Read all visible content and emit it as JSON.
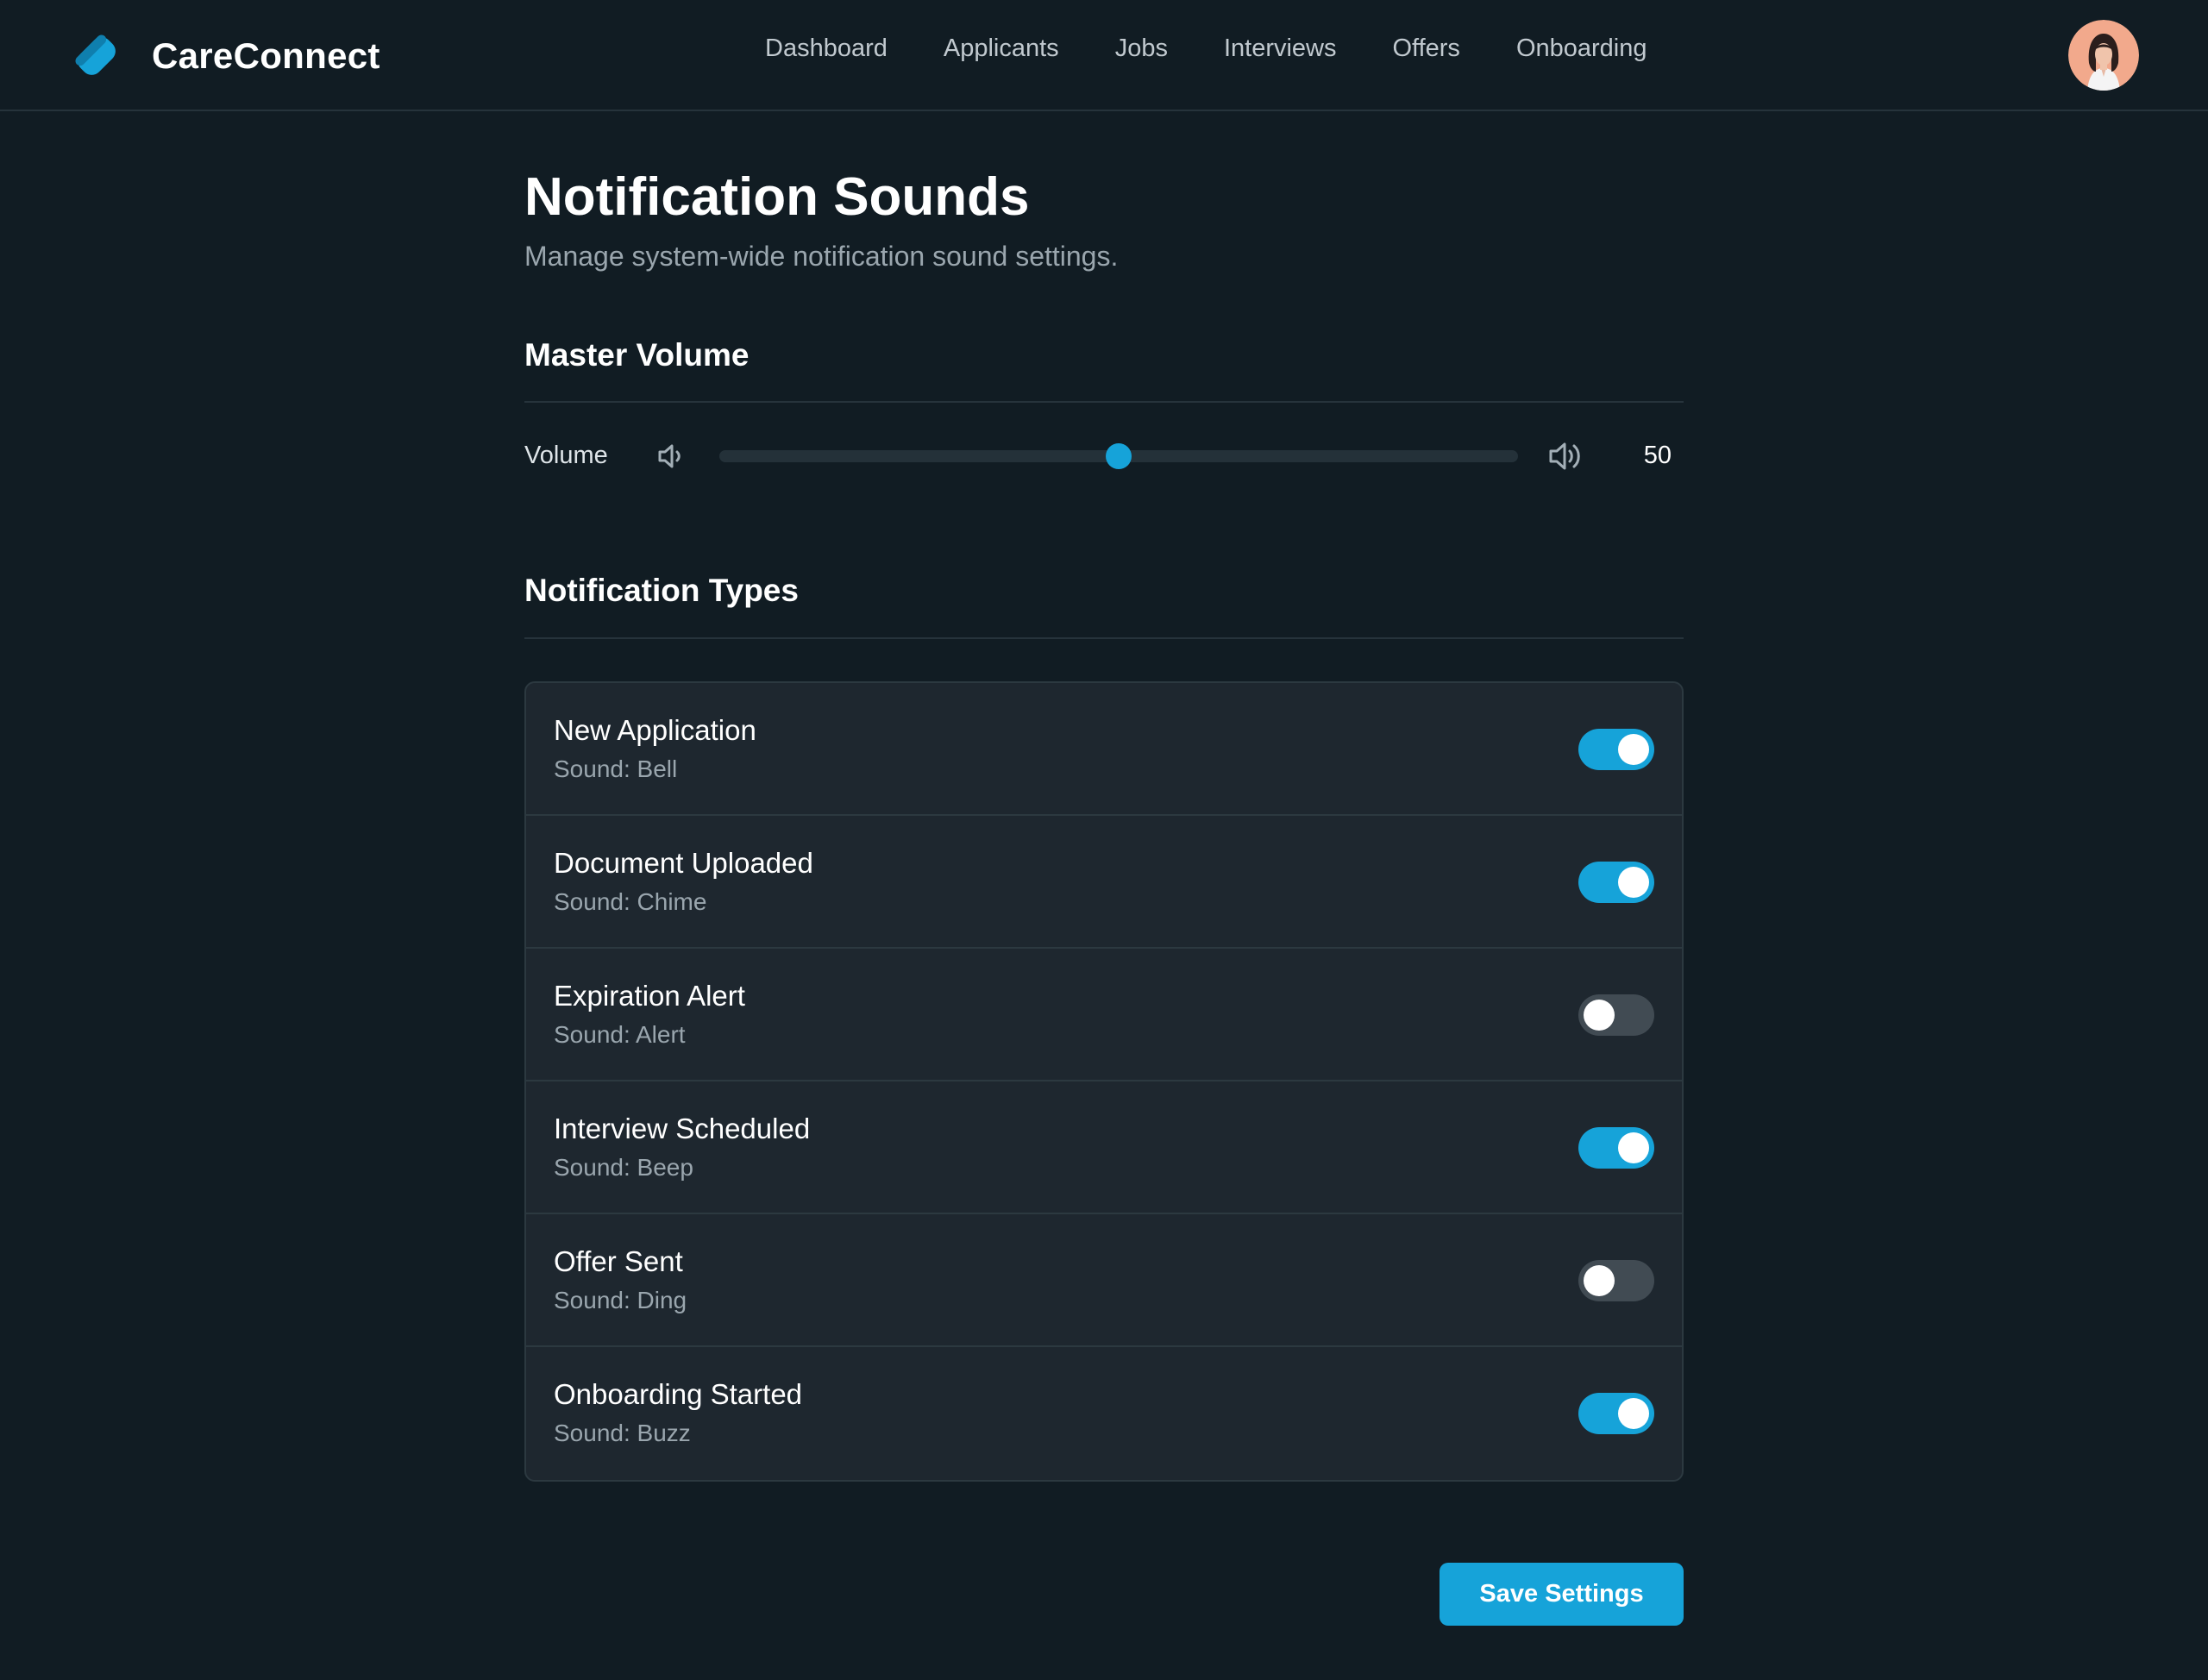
{
  "app": {
    "name": "CareConnect",
    "accent_color": "#16a3d9",
    "logo_icon": "tag-icon"
  },
  "nav": {
    "items": [
      {
        "label": "Dashboard"
      },
      {
        "label": "Applicants"
      },
      {
        "label": "Jobs"
      },
      {
        "label": "Interviews"
      },
      {
        "label": "Offers"
      },
      {
        "label": "Onboarding"
      }
    ]
  },
  "user": {
    "avatar_icon": "user-avatar"
  },
  "page": {
    "title": "Notification Sounds",
    "subtitle": "Manage system-wide notification sound settings."
  },
  "master_volume": {
    "section_title": "Master Volume",
    "label": "Volume",
    "value": "50",
    "level": 0.5,
    "low_icon": "volume-low-icon",
    "high_icon": "volume-high-icon"
  },
  "notification_types": {
    "section_title": "Notification Types",
    "items": [
      {
        "name": "New Application",
        "sound": "Sound: Bell",
        "enabled": true
      },
      {
        "name": "Document Uploaded",
        "sound": "Sound: Chime",
        "enabled": true
      },
      {
        "name": "Expiration Alert",
        "sound": "Sound: Alert",
        "enabled": false
      },
      {
        "name": "Interview Scheduled",
        "sound": "Sound: Beep",
        "enabled": true
      },
      {
        "name": "Offer Sent",
        "sound": "Sound: Ding",
        "enabled": false
      },
      {
        "name": "Onboarding Started",
        "sound": "Sound: Buzz",
        "enabled": true
      }
    ]
  },
  "actions": {
    "save_label": "Save Settings"
  }
}
